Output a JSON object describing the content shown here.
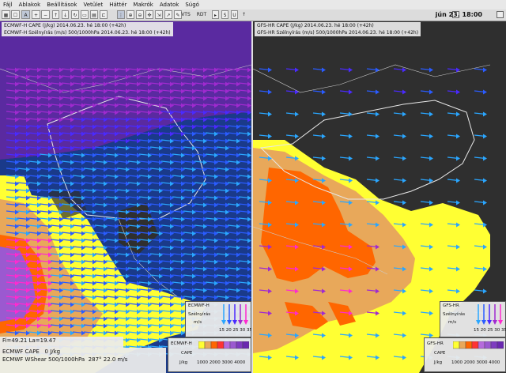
{
  "menu": [
    "Fájl",
    "Ablakok",
    "Beállítások",
    "Vetület",
    "Háttér",
    "Makrók",
    "Adatok",
    "Súgó"
  ],
  "toolbar": {
    "btn_a_label": "A",
    "vts_label": "VTS",
    "rdt_label": "RDT",
    "s_label": "S",
    "u_label": "U"
  },
  "clock": "jún 23. 18:00",
  "left_panel": {
    "title_line1": "ECMWF-H CAPE (J/kg) 2014.06.23. hé 18:00 (+42h)",
    "title_line2": "ECMWF-H Szélnyírás (m/s) 500/1000hPa 2014.06.23. hé 18:00 (+42h)",
    "wind_legend": {
      "model": "ECMWF-H",
      "name": "Szélnyírás",
      "unit": "m/s",
      "ticks": [
        "15",
        "20",
        "25",
        "30",
        "35"
      ]
    },
    "cape_legend": {
      "model": "ECMWF-H",
      "name": "CAPE",
      "unit": "J/kg",
      "ticks": [
        "1000",
        "2000",
        "3000",
        "4000"
      ]
    },
    "cursor": {
      "coords": "Fi=49.21  La=19.47",
      "cape_name": "ECMWF CAPE",
      "cape_value": "0 J/kg",
      "wshear_name": "ECMWF WShear 500/1000hPa",
      "wshear_value": "287° 22.0 m/s"
    }
  },
  "right_panel": {
    "title_line1": "GFS-HR CAPE (J/kg) 2014.06.23. hé 18:00 (+42h)",
    "title_line2": "GFS-HR Szélnyírás (m/s) 500/1000hPa 2014.06.23. hé 18:00 (+42h)",
    "wind_legend": {
      "model": "GFS-HR",
      "name": "Szélnyírás",
      "unit": "m/s",
      "ticks": [
        "15",
        "20",
        "25",
        "30",
        "35"
      ]
    },
    "cape_legend": {
      "model": "GFS-HR",
      "name": "CAPE",
      "unit": "J/kg",
      "ticks": [
        "1000",
        "2000",
        "3000",
        "4000"
      ]
    }
  },
  "colors": {
    "background_map": "#2f2f2f",
    "cape_1000": "#ffff33",
    "cape_2000": "#e8a85a",
    "cape_3000": "#ff6600",
    "cape_4000": "#9b59d0",
    "arrow_15": "#2aa6ff",
    "arrow_20": "#2a5cff",
    "arrow_25": "#4a2aff",
    "arrow_30": "#a02ad0",
    "arrow_35": "#ff2ad0"
  },
  "icons": [
    "grid-icon",
    "text-icon",
    "zoom-in-icon",
    "zoom-out-icon",
    "refresh-icon",
    "pan-icon",
    "select-icon",
    "measure-icon",
    "pin-icon",
    "calendar-icon",
    "settings-icon"
  ]
}
